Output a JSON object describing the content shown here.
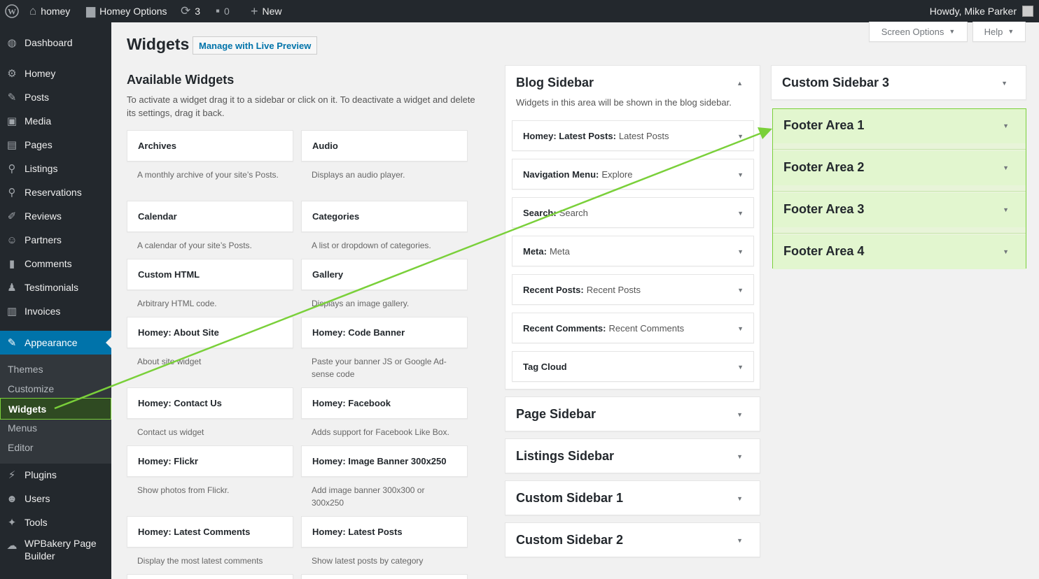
{
  "adminbar": {
    "wp_logo": "wordpress-icon",
    "site_name": "homey",
    "theme_options": "Homey Options",
    "updates_count": "3",
    "comments_count": "0",
    "new_label": "New",
    "howdy": "Howdy, Mike Parker"
  },
  "menu": {
    "dashboard": "Dashboard",
    "homey": "Homey",
    "posts": "Posts",
    "media": "Media",
    "pages": "Pages",
    "listings": "Listings",
    "reservations": "Reservations",
    "reviews": "Reviews",
    "partners": "Partners",
    "comments": "Comments",
    "testimonials": "Testimonials",
    "invoices": "Invoices",
    "appearance": "Appearance",
    "plugins": "Plugins",
    "users": "Users",
    "tools": "Tools",
    "wpbakery_1": "WPBakery Page",
    "wpbakery_2": "Builder"
  },
  "submenu": {
    "themes": "Themes",
    "customize": "Customize",
    "widgets": "Widgets",
    "menus": "Menus",
    "editor": "Editor"
  },
  "screen_options": "Screen Options",
  "help": "Help",
  "page_title": "Widgets",
  "live_preview": "Manage with Live Preview",
  "available": {
    "title": "Available Widgets",
    "description": "To activate a widget drag it to a sidebar or click on it. To deactivate a widget and delete its settings, drag it back.",
    "widgets": [
      {
        "name": "Archives",
        "desc": "A monthly archive of your site’s Posts."
      },
      {
        "name": "Audio",
        "desc": "Displays an audio player."
      },
      {
        "name": "Calendar",
        "desc": "A calendar of your site’s Posts."
      },
      {
        "name": "Categories",
        "desc": "A list or dropdown of categories."
      },
      {
        "name": "Custom HTML",
        "desc": "Arbitrary HTML code."
      },
      {
        "name": "Gallery",
        "desc": "Displays an image gallery."
      },
      {
        "name": "Homey: About Site",
        "desc": "About site widget"
      },
      {
        "name": "Homey: Code Banner",
        "desc": "Paste your banner JS or Google Ad-sense code"
      },
      {
        "name": "Homey: Contact Us",
        "desc": "Contact us widget"
      },
      {
        "name": "Homey: Facebook",
        "desc": "Adds support for Facebook Like Box."
      },
      {
        "name": "Homey: Flickr",
        "desc": "Show photos from Flickr."
      },
      {
        "name": "Homey: Image Banner 300x250",
        "desc": "Add image banner 300x300 or 300x250"
      },
      {
        "name": "Homey: Latest Comments",
        "desc": "Display the most latest comments"
      },
      {
        "name": "Homey: Latest Posts",
        "desc": "Show latest posts by category"
      }
    ]
  },
  "blog_sidebar": {
    "title": "Blog Sidebar",
    "description": "Widgets in this area will be shown in the blog sidebar.",
    "widgets": [
      {
        "name": "Homey: Latest Posts:",
        "title": "Latest Posts"
      },
      {
        "name": "Navigation Menu:",
        "title": "Explore"
      },
      {
        "name": "Search:",
        "title": "Search"
      },
      {
        "name": "Meta:",
        "title": "Meta"
      },
      {
        "name": "Recent Posts:",
        "title": "Recent Posts"
      },
      {
        "name": "Recent Comments:",
        "title": "Recent Comments"
      },
      {
        "name": "Tag Cloud",
        "title": ""
      }
    ]
  },
  "sidebars_mid": [
    "Page Sidebar",
    "Listings Sidebar",
    "Custom Sidebar 1",
    "Custom Sidebar 2"
  ],
  "custom_sidebar_3": "Custom Sidebar 3",
  "footer_areas": [
    "Footer Area 1",
    "Footer Area 2",
    "Footer Area 3",
    "Footer Area 4"
  ],
  "icons": {
    "toggle_open": "▲",
    "toggle_closed": "▼"
  },
  "colors": {
    "admin_dark": "#23282d",
    "accent_blue": "#0073aa",
    "highlight_green": "#7ad03a",
    "footer_green": "#e2f6cf"
  }
}
